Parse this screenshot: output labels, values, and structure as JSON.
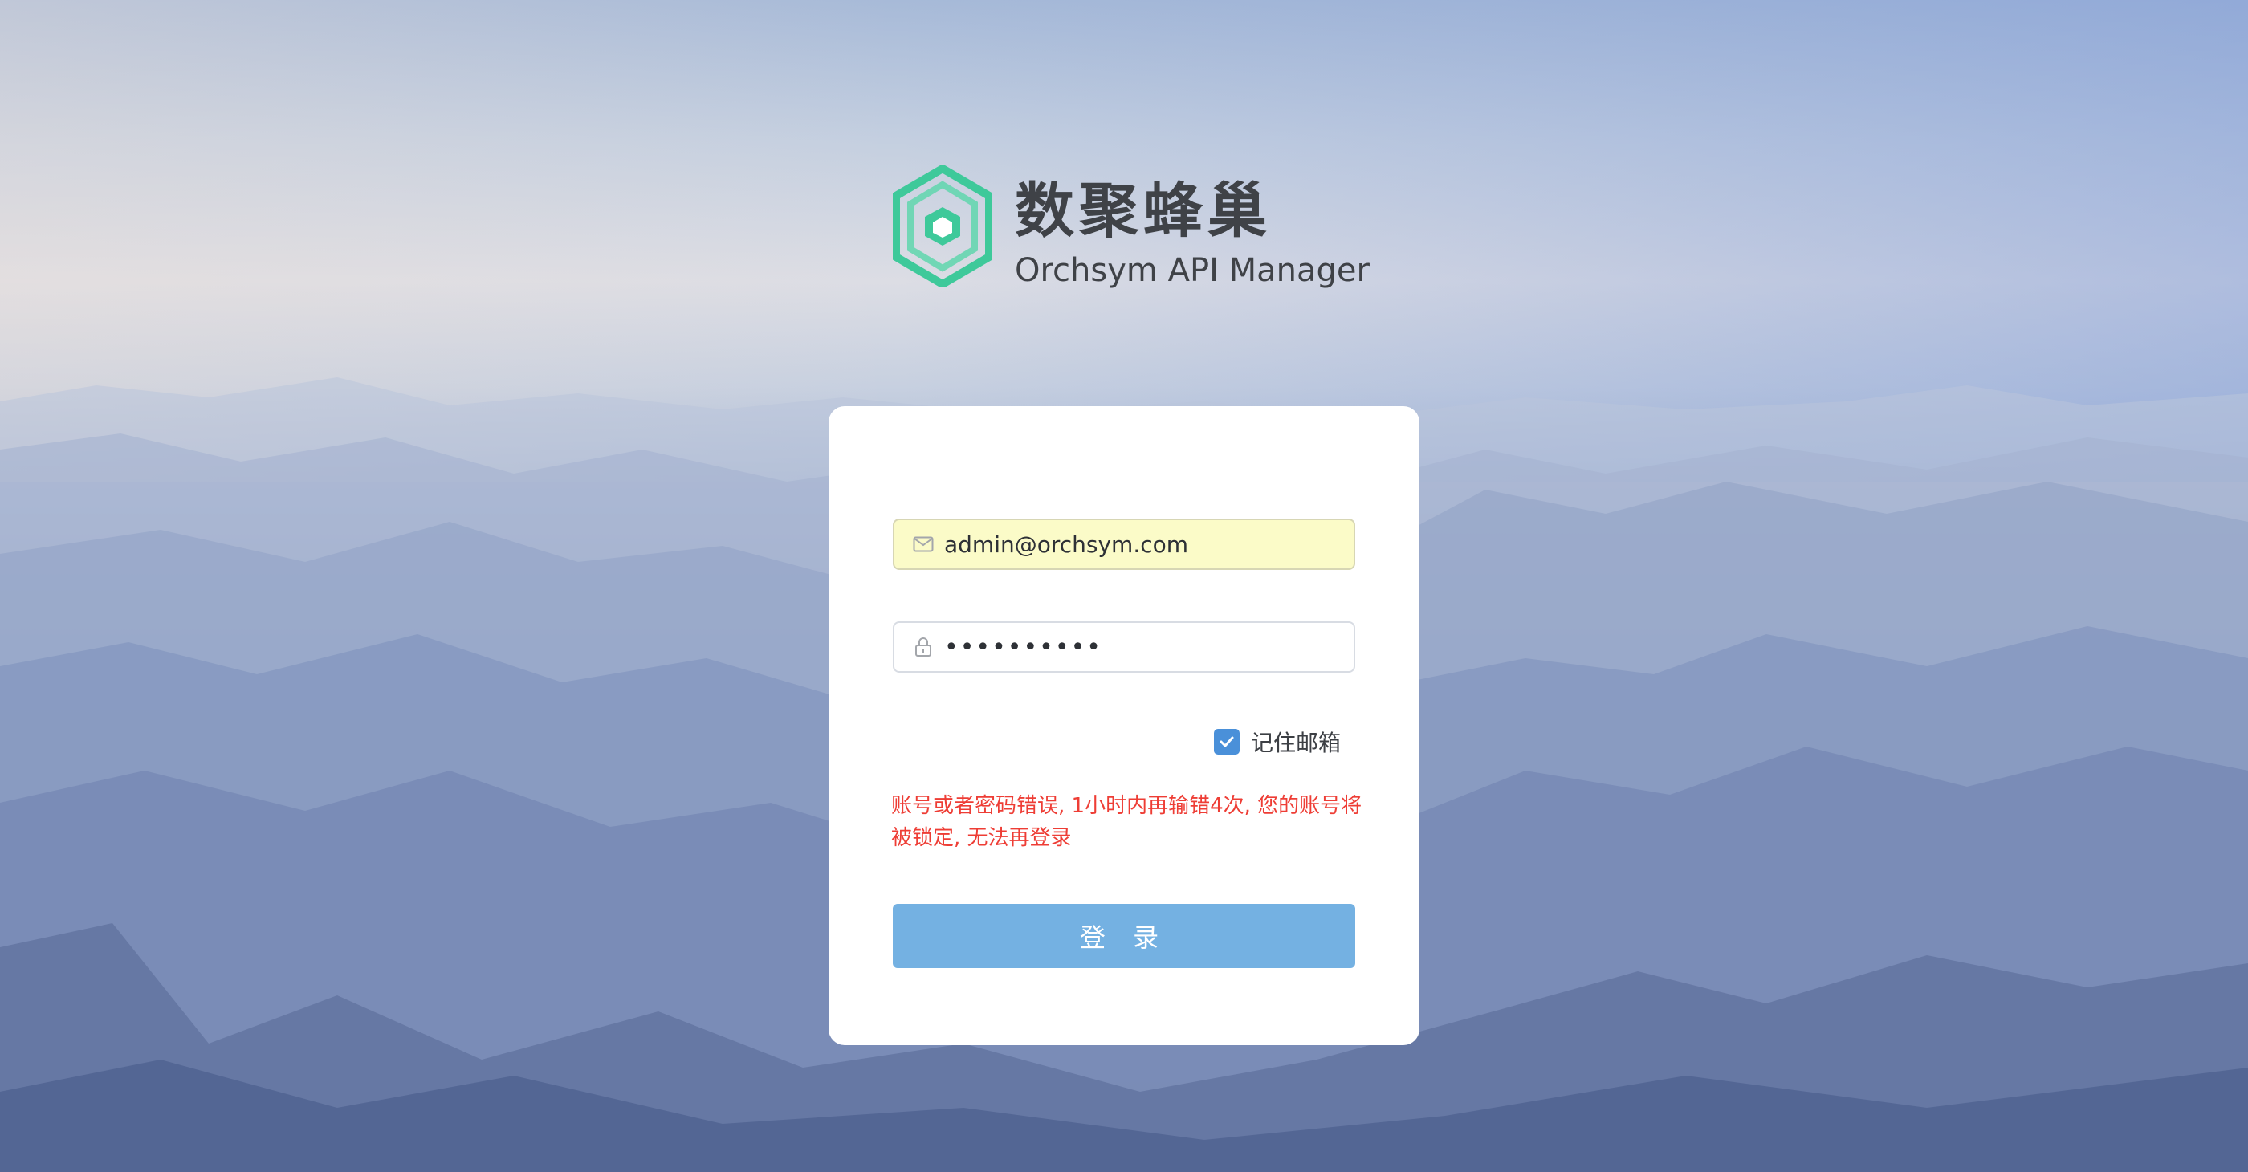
{
  "brand": {
    "name_cn": "数聚蜂巢",
    "name_en": "Orchsym API Manager",
    "logo_color": "#3ec99a"
  },
  "login_form": {
    "email": {
      "icon": "mail-icon",
      "value": "admin@orchsym.com"
    },
    "password": {
      "icon": "lock-icon",
      "value": "••••••••••"
    },
    "remember_email": {
      "label": "记住邮箱",
      "checked": true
    },
    "error_message": "账号或者密码错误, 1小时内再输错4次, 您的账号将被锁定, 无法再登录",
    "submit_label": "登 录"
  },
  "colors": {
    "accent": "#4a90d9",
    "button": "#74b1e2",
    "error": "#ee3d35",
    "autofill": "#fbfbc8"
  }
}
